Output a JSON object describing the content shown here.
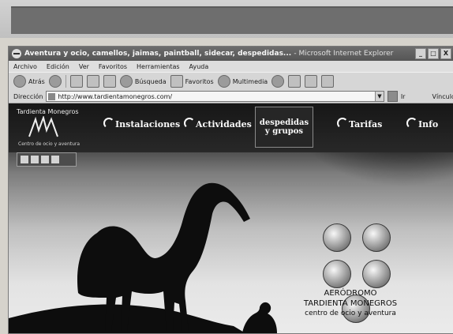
{
  "window": {
    "title_main": "Aventura y ocio, camellos, jaimas, paintball, sidecar, despedidas...",
    "title_suffix": "- Microsoft Internet Explorer",
    "btn_min": "_",
    "btn_max": "□",
    "btn_close": "X"
  },
  "menubar": {
    "items": [
      "Archivo",
      "Edición",
      "Ver",
      "Favoritos",
      "Herramientas",
      "Ayuda"
    ]
  },
  "toolbar": {
    "back_label": "Atrás",
    "search_label": "Búsqueda",
    "favorites_label": "Favoritos",
    "multimedia_label": "Multimedia"
  },
  "addressbar": {
    "label": "Dirección",
    "url": "http://www.tardientamonegros.com/",
    "go_label": "Ir",
    "links_label": "Vínculos"
  },
  "site": {
    "brand": "Tardienta Monegros",
    "logo_caption": "Centro de ocio y aventura",
    "nav": {
      "instalaciones": "Instalaciones",
      "actividades": "Actividades",
      "despedidas_line1": "despedidas",
      "despedidas_line2": "y grupos",
      "tarifas": "Tarifas",
      "info": "Info"
    },
    "footer": {
      "line1": "AERÓDROMO",
      "line2": "TARDIENTA MONEGROS",
      "line3": "centro de ocio y aventura"
    }
  },
  "colors": {
    "header_bg": "#1c1c1c",
    "sky_light": "#e6e6e4",
    "silhouette": "#121212"
  }
}
